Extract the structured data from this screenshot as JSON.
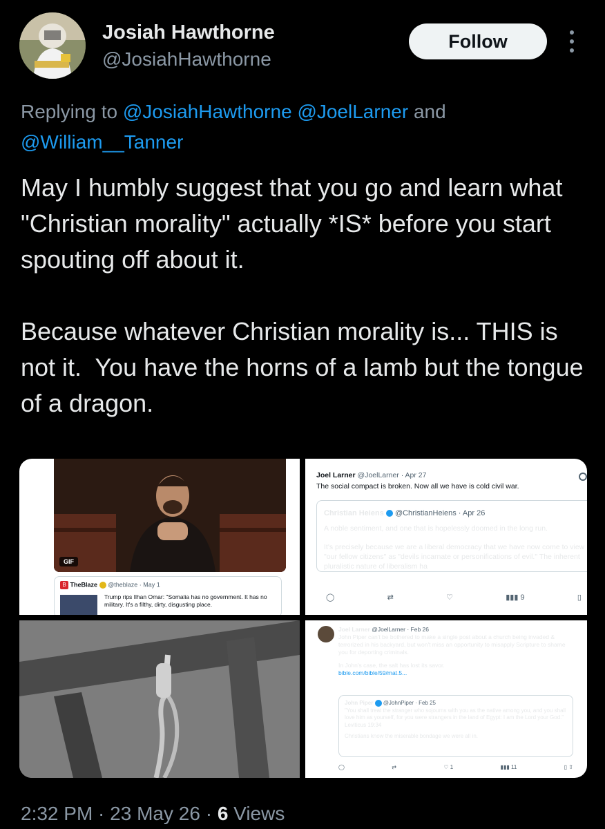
{
  "author": {
    "display_name": "Josiah Hawthorne",
    "handle": "@JosiahHawthorne",
    "avatar_desc": "beekeeper-avatar"
  },
  "follow_label": "Follow",
  "reply": {
    "prefix": "Replying to ",
    "mention1": "@JosiahHawthorne",
    "mention2": "@JoelLarner",
    "joiner": " and",
    "mention3": "@William__Tanner"
  },
  "tweet_text": "May I humbly suggest that you go and learn what \"Christian morality\" actually *IS* before you start spouting off about it.\n\nBecause whatever Christian morality is... THIS is not it.  You have the horns of a lamb but the tongue of a dragon.",
  "media": {
    "tile1": {
      "gif_badge": "GIF",
      "embed_source": "TheBlaze",
      "embed_handle": "@theblaze · May 1",
      "embed_text": "Trump rips Ilhan Omar: \"Somalia has no government. It has no military. It's a filthy, dirty, disgusting place."
    },
    "tile2": {
      "author": "Joel Larner",
      "meta": "@JoelLarner · Apr 27",
      "body": "The social compact is broken. Now all we have is cold civil war.",
      "quote_author": "Christian Heiens",
      "quote_meta": "@ChristianHeiens · Apr 26",
      "quote_p1": "A noble sentiment, and one that is hopelessly doomed in the long run.",
      "quote_p2": "It's precisely because we are a liberal democracy that we have now come to view \"our fellow citizens\" as \"devils incarnate or personifications of evil.\" The inherent pluralistic nature of liberalism ha",
      "views": "9"
    },
    "tile4": {
      "author": "Joel Larner",
      "meta": "@JoelLarner · Feb 26",
      "body": "John Piper can't be bothered to make a single post about a church being invaded & terrorized in his backyard, but won't miss an opportunity to misapply Scripture to shame you for deporting criminals.",
      "body2": "In John's case, the salt has lost its savor.",
      "link": "bible.com/bible/59/mat.5...",
      "quote_author": "John Piper",
      "quote_meta": "@JohnPiper · Feb 25",
      "quote_text": "\"You shall treat the stranger who sojourns with you as the native among you, and you shall love him as yourself, for you were strangers in the land of Egypt: I am the Lord your God.\" Leviticus 19:34",
      "quote_text2": "Christians know the miserable bondage we were all in.",
      "likes": "1",
      "views": "11"
    }
  },
  "footer": {
    "time": "2:32 PM",
    "sep1": " · ",
    "date": "23 May 26",
    "sep2": " · ",
    "views_count": "6",
    "views_label": " Views"
  },
  "colors": {
    "background": "#000000",
    "text": "#e7e9ea",
    "muted": "#8b98a5",
    "accent": "#1d9bf0"
  }
}
